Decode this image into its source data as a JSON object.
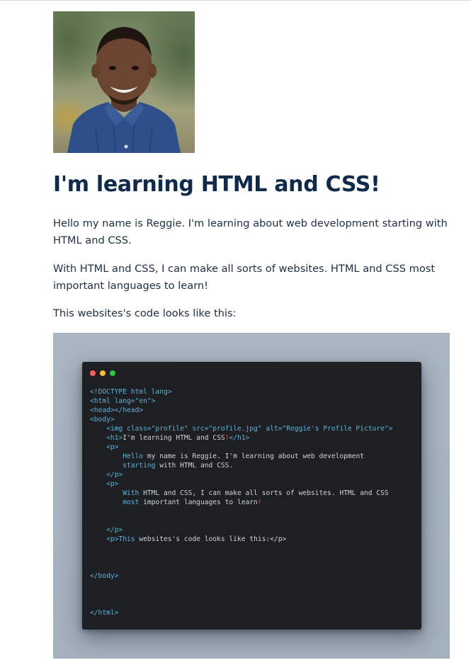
{
  "photo": {
    "alt": "Reggie's Profile Picture"
  },
  "heading": "I'm learning HTML and CSS!",
  "paragraphs": [
    "Hello my name is Reggie. I'm learning about web development starting with HTML and CSS.",
    "With HTML and CSS, I can make all sorts of websites. HTML and CSS most important languages to learn!",
    "This websites's code looks like this:"
  ],
  "code": {
    "window_buttons": [
      "close",
      "minimize",
      "maximize"
    ],
    "lines": [
      [
        {
          "t": "<!DOCTYPE html lang>",
          "c": "tag"
        }
      ],
      [
        {
          "t": "<html lang=\"en\">",
          "c": "tag"
        }
      ],
      [
        {
          "t": "<head></head>",
          "c": "tag"
        }
      ],
      [
        {
          "t": "<body>",
          "c": "tag"
        }
      ],
      [
        {
          "t": "    <img class=\"profile\" src=\"profile.jpg\" alt=\"Reggie's Profile Picture\">",
          "c": "tag"
        }
      ],
      [
        {
          "t": "    <h1>",
          "c": "tag"
        },
        {
          "t": "I'm learning HTML and CSS",
          "c": "text"
        },
        {
          "t": "!",
          "c": "bang"
        },
        {
          "t": "</h1>",
          "c": "tag"
        }
      ],
      [
        {
          "t": "    <p>",
          "c": "tag"
        }
      ],
      [
        {
          "t": "        Hello ",
          "c": "tag"
        },
        {
          "t": "my name is Reggie. I'm learning about web development",
          "c": "text"
        }
      ],
      [
        {
          "t": "        starting ",
          "c": "tag"
        },
        {
          "t": "with HTML and CSS.",
          "c": "text"
        }
      ],
      [
        {
          "t": "    </p>",
          "c": "tag"
        }
      ],
      [
        {
          "t": "    <p>",
          "c": "tag"
        }
      ],
      [
        {
          "t": "        With ",
          "c": "tag"
        },
        {
          "t": "HTML and CSS, I can make all sorts of websites. HTML and CSS",
          "c": "text"
        }
      ],
      [
        {
          "t": "        most ",
          "c": "tag"
        },
        {
          "t": "important languages to learn",
          "c": "text"
        },
        {
          "t": "!",
          "c": "bang"
        }
      ],
      [],
      [],
      [
        {
          "t": "    </p>",
          "c": "tag"
        }
      ],
      [
        {
          "t": "    <p>This ",
          "c": "tag"
        },
        {
          "t": "websites's code looks like this:</p>",
          "c": "text"
        }
      ],
      [],
      [],
      [],
      [
        {
          "t": "</body>",
          "c": "tag"
        }
      ],
      [],
      [],
      [],
      [
        {
          "t": "</html>",
          "c": "tag"
        }
      ]
    ]
  },
  "colors": {
    "heading": "#0f2a4a",
    "body_text": "#1e2f45",
    "code_bg": "#1d1f23",
    "code_tag": "#5fb2d8",
    "code_text": "#cfd3d8",
    "code_bang": "#e0564f",
    "frame_bg": "#a9b6c2"
  }
}
